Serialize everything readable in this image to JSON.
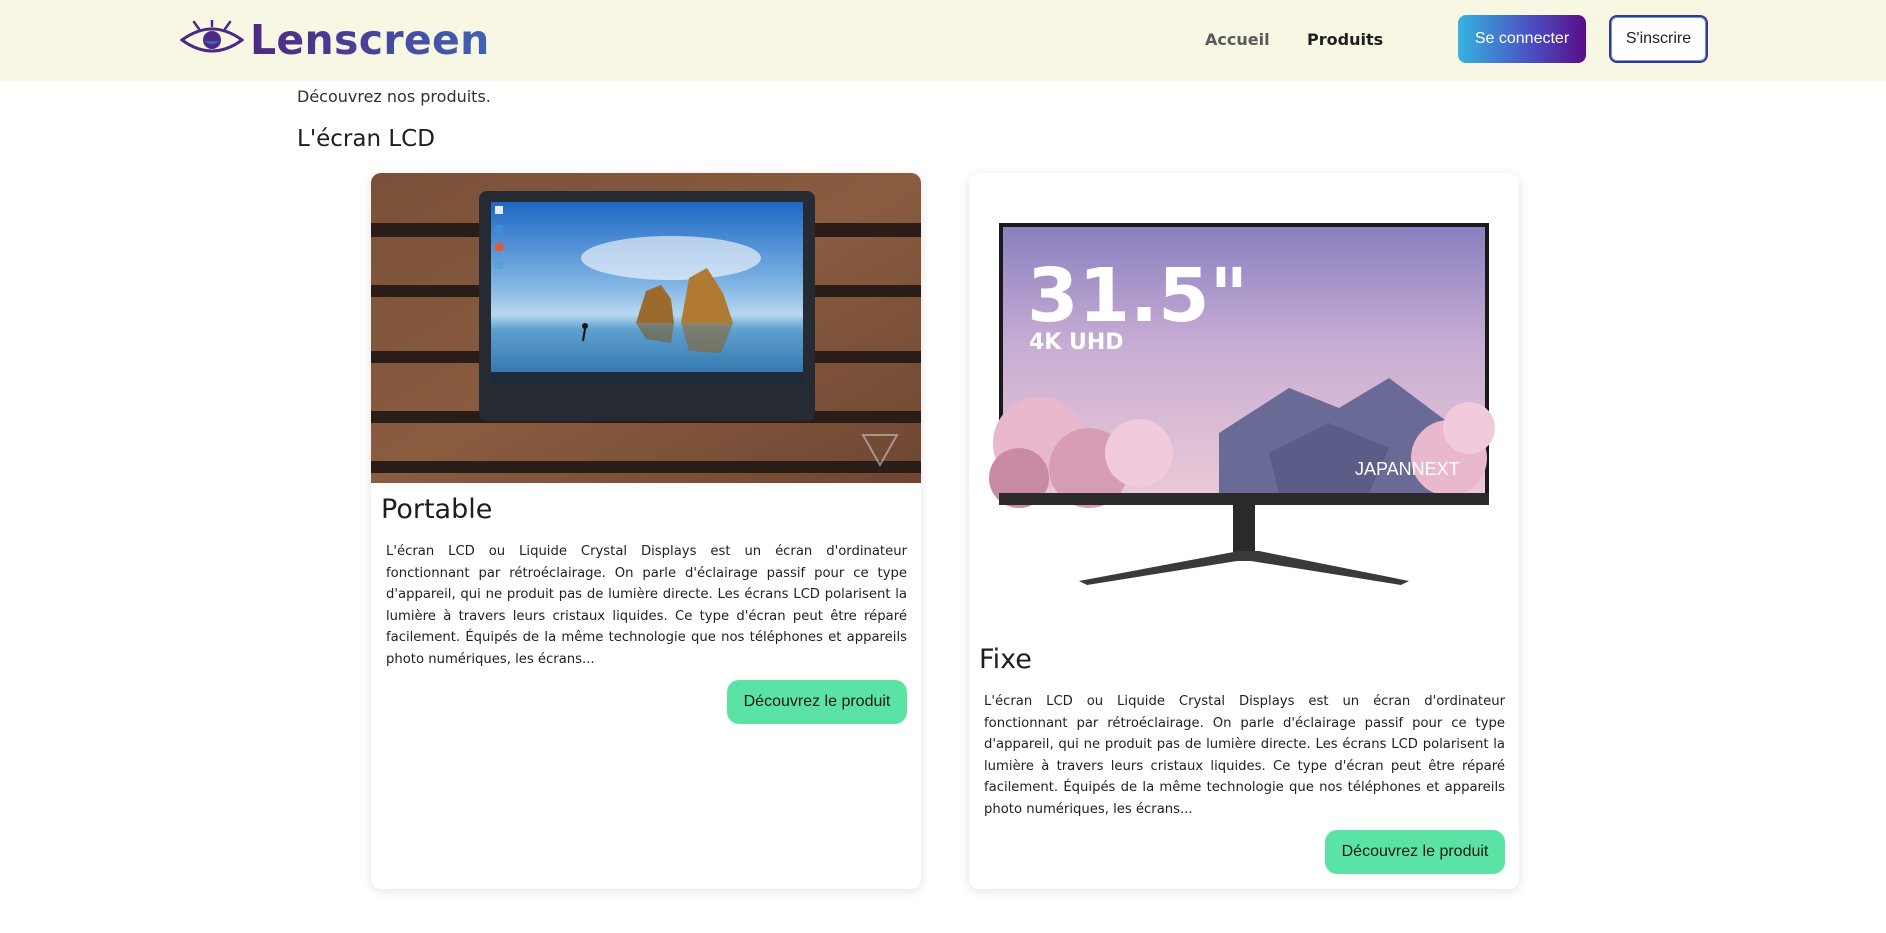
{
  "header": {
    "brand": "Lenscreen",
    "nav": {
      "accueil": "Accueil",
      "produits": "Produits"
    },
    "login_label": "Se connecter",
    "signup_label": "S'inscrire"
  },
  "intro": "Découvrez nos produits.",
  "section_title": "L'écran LCD",
  "products": [
    {
      "title": "Portable",
      "description": "L'écran LCD ou Liquide Crystal Displays est un écran d'ordinateur fonctionnant par rétroéclairage. On parle d'éclairage passif pour ce type d'appareil, qui ne produit pas de lumière directe. Les écrans LCD polarisent la lumière à travers leurs cristaux liquides. Ce type d'écran peut être réparé facilement. Équipés de la même technologie que nos téléphones et appareils photo numériques, les écrans...",
      "button": "Découvrez le produit"
    },
    {
      "title": "Fixe",
      "description": "L'écran LCD ou Liquide Crystal Displays est un écran d'ordinateur fonctionnant par rétroéclairage. On parle d'éclairage passif pour ce type d'appareil, qui ne produit pas de lumière directe. Les écrans LCD polarisent la lumière à travers leurs cristaux liquides. Ce type d'écran peut être réparé facilement. Équipés de la même technologie que nos téléphones et appareils photo numériques, les écrans...",
      "button": "Découvrez le produit",
      "image_text": {
        "size": "31.5\"",
        "resolution": "4K UHD",
        "maker": "JAPANNEXT"
      }
    }
  ],
  "colors": {
    "header_bg": "#f7f7e4",
    "accent_green": "#5be3a6",
    "brand_purple": "#4b2a84",
    "brand_blue": "#3f62b4"
  },
  "icons": {
    "logo": "eye-icon"
  }
}
